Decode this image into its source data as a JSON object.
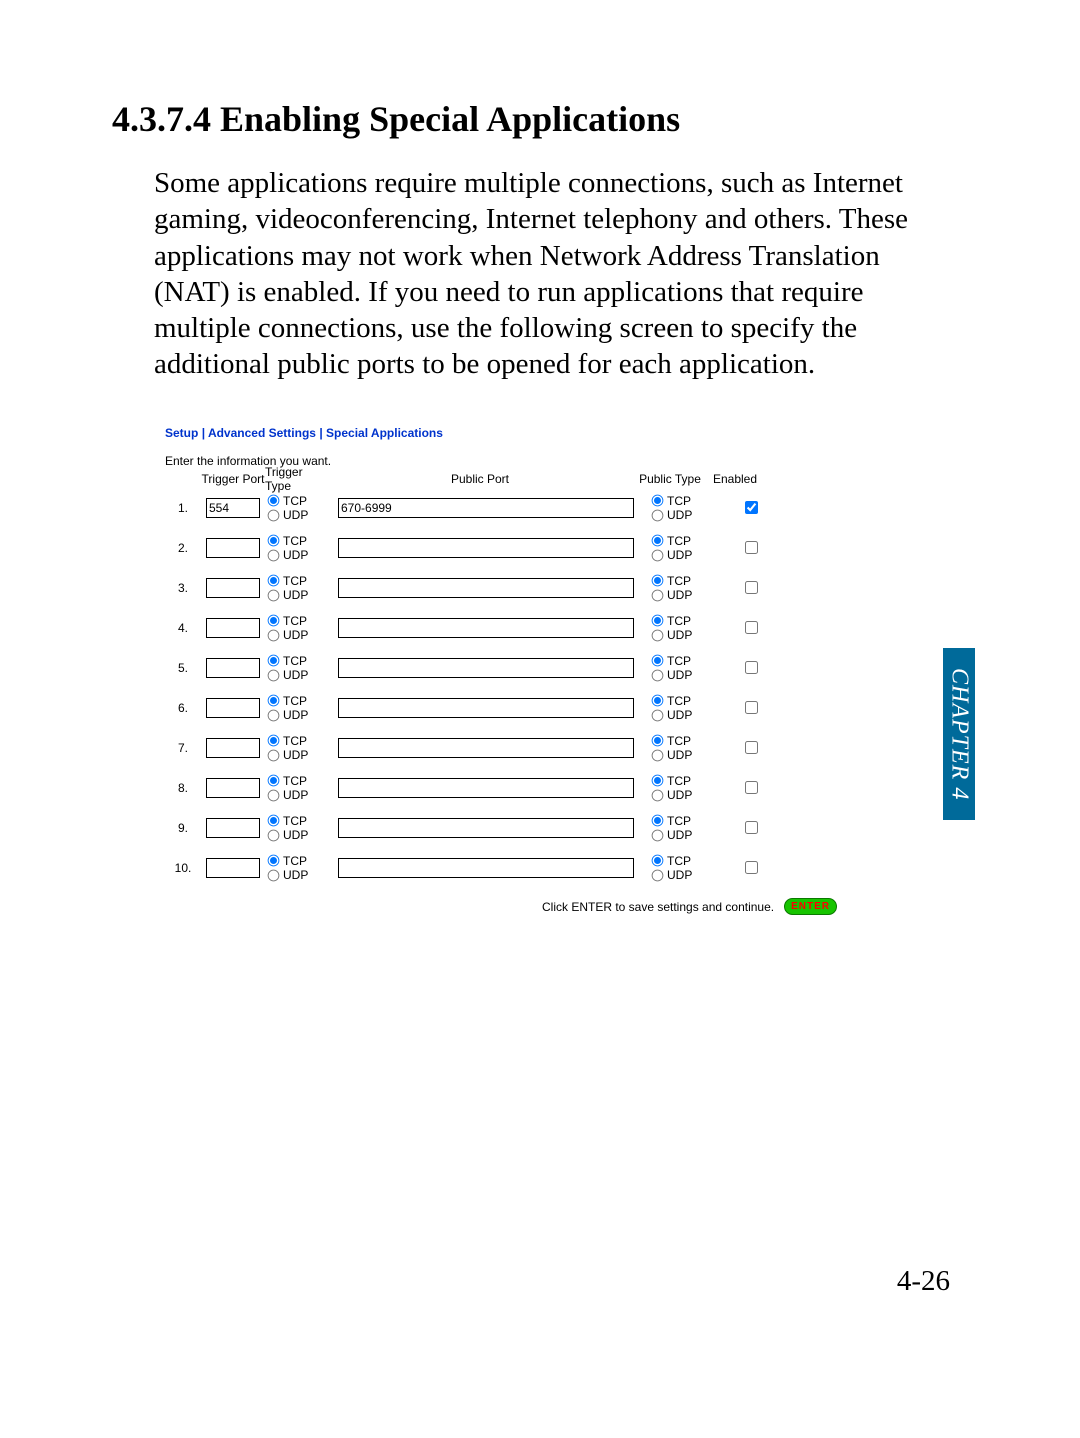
{
  "heading": "4.3.7.4 Enabling Special Applications",
  "paragraph": "Some applications require multiple connections, such as Internet gaming, videoconferencing, Internet telephony and others. These applications may not work when Network Address Translation (NAT) is enabled. If you need to run applications that require multiple connections, use the following screen to specify the additional public ports to be opened for each application.",
  "chapter_tab": "CHAPTER 4",
  "page_number": "4-26",
  "panel": {
    "breadcrumb": {
      "a": "Setup",
      "sep": " | ",
      "b": "Advanced Settings",
      "c": "Special Applications"
    },
    "intro": "Enter the information you want.",
    "headers": {
      "trigger_port": "Trigger Port",
      "trigger_type": "Trigger Type",
      "public_port": "Public Port",
      "public_type": "Public Type",
      "enabled": "Enabled"
    },
    "radio_labels": {
      "tcp": "TCP",
      "udp": "UDP"
    },
    "rows": [
      {
        "num": "1.",
        "trigger_port": "554",
        "trigger_type": "TCP",
        "public_port": "670-6999",
        "public_type": "TCP",
        "enabled": true
      },
      {
        "num": "2.",
        "trigger_port": "",
        "trigger_type": "TCP",
        "public_port": "",
        "public_type": "TCP",
        "enabled": false
      },
      {
        "num": "3.",
        "trigger_port": "",
        "trigger_type": "TCP",
        "public_port": "",
        "public_type": "TCP",
        "enabled": false
      },
      {
        "num": "4.",
        "trigger_port": "",
        "trigger_type": "TCP",
        "public_port": "",
        "public_type": "TCP",
        "enabled": false
      },
      {
        "num": "5.",
        "trigger_port": "",
        "trigger_type": "TCP",
        "public_port": "",
        "public_type": "TCP",
        "enabled": false
      },
      {
        "num": "6.",
        "trigger_port": "",
        "trigger_type": "TCP",
        "public_port": "",
        "public_type": "TCP",
        "enabled": false
      },
      {
        "num": "7.",
        "trigger_port": "",
        "trigger_type": "TCP",
        "public_port": "",
        "public_type": "TCP",
        "enabled": false
      },
      {
        "num": "8.",
        "trigger_port": "",
        "trigger_type": "TCP",
        "public_port": "",
        "public_type": "TCP",
        "enabled": false
      },
      {
        "num": "9.",
        "trigger_port": "",
        "trigger_type": "TCP",
        "public_port": "",
        "public_type": "TCP",
        "enabled": false
      },
      {
        "num": "10.",
        "trigger_port": "",
        "trigger_type": "TCP",
        "public_port": "",
        "public_type": "TCP",
        "enabled": false
      }
    ],
    "footer_text": "Click ENTER to save settings and continue.",
    "enter_label": "ENTER"
  }
}
